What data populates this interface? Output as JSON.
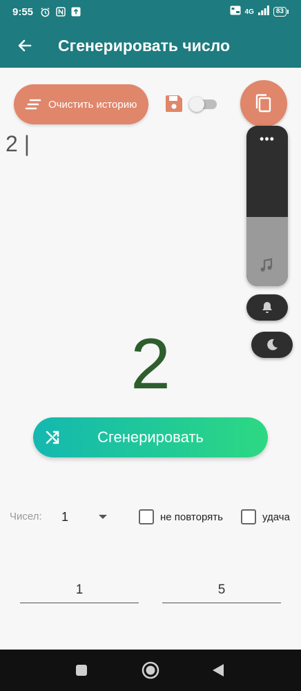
{
  "status": {
    "time": "9:55",
    "network": "4G",
    "battery": "83"
  },
  "appbar": {
    "title": "Сгенерировать число"
  },
  "actions": {
    "clear_history_label": "Очистить историю"
  },
  "history": {
    "text": "2 |"
  },
  "result": {
    "value": "2"
  },
  "volume_panel": {
    "dots_label": "•••",
    "level_percent": 43
  },
  "generate": {
    "label": "Сгенерировать"
  },
  "options": {
    "count_label": "Чисел:",
    "count_value": "1",
    "no_repeat_label": "не повторять",
    "luck_label": "удача"
  },
  "range": {
    "min": "1",
    "max": "5"
  },
  "colors": {
    "primary": "#1e7b7f",
    "accent": "#e0866a",
    "number": "#2e5e2e"
  }
}
